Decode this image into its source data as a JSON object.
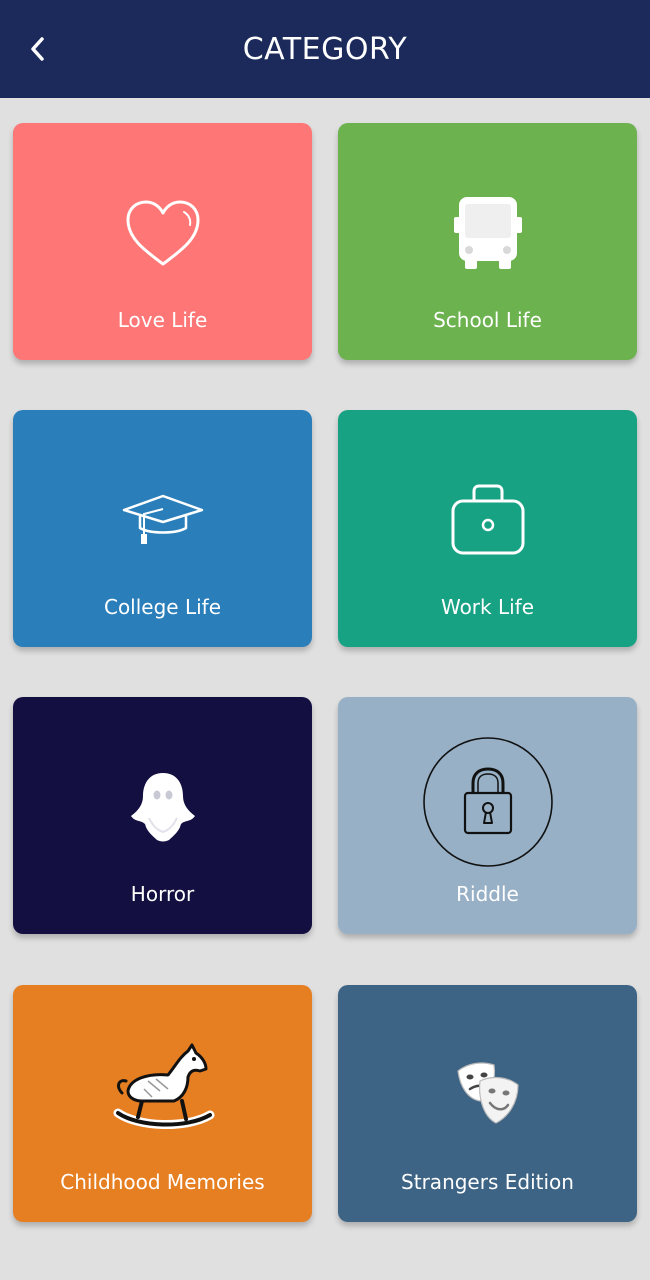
{
  "header": {
    "title": "CATEGORY",
    "background": "#1b2a5a",
    "back_icon": "chevron-left-icon"
  },
  "categories": [
    {
      "label": "Love Life",
      "color": "#ff7676",
      "icon": "heart-icon"
    },
    {
      "label": "School Life",
      "color": "#6cb24e",
      "icon": "bus-icon"
    },
    {
      "label": "College Life",
      "color": "#2a7fbb",
      "icon": "graduation-cap-icon"
    },
    {
      "label": "Work Life",
      "color": "#17a284",
      "icon": "briefcase-icon"
    },
    {
      "label": "Horror",
      "color": "#130f40",
      "icon": "ghost-icon"
    },
    {
      "label": "Riddle",
      "color": "#97b0c6",
      "icon": "padlock-icon"
    },
    {
      "label": "Childhood Memories",
      "color": "#e67e22",
      "icon": "rocking-horse-icon"
    },
    {
      "label": "Strangers Edition",
      "color": "#3d6385",
      "icon": "theater-masks-icon"
    }
  ]
}
